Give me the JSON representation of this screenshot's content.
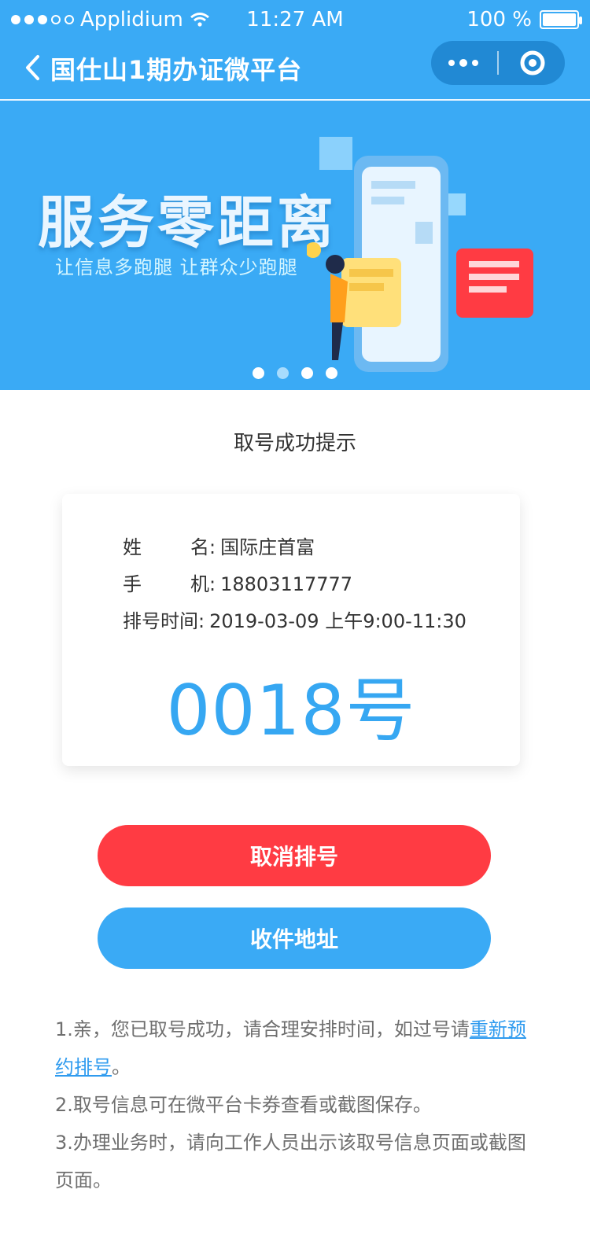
{
  "status_bar": {
    "carrier": "Applidium",
    "time": "11:27 AM",
    "battery_text": "100 %"
  },
  "nav": {
    "title": "国仕山1期办证微平台"
  },
  "banner": {
    "title": "服务零距离",
    "subtitle": "让信息多跑腿 让群众少跑腿",
    "active_index": 1
  },
  "section": {
    "title": "取号成功提示"
  },
  "ticket_card": {
    "fields": [
      {
        "label": "姓名",
        "value": "国际庄首富"
      },
      {
        "label": "手机",
        "value": "18803117777"
      },
      {
        "label": "排号时间",
        "value": "2019-03-09 上午9:00-11:30"
      }
    ],
    "ticket_number": "0018号"
  },
  "actions": {
    "cancel_label": "取消排号",
    "address_label": "收件地址"
  },
  "notes": {
    "line1_prefix": "1.亲，您已取号成功，请合理安排时间，如过号请",
    "line1_link": "重新预约排号",
    "line1_suffix": "。",
    "line2": "2.取号信息可在微平台卡券查看或截图保存。",
    "line3": "3.办理业务时，请向工作人员出示该取号信息页面或截图页面。"
  },
  "colors": {
    "primary": "#3aaaf5",
    "danger": "#ff3b43",
    "accent": "#36a7f2"
  },
  "icons": {
    "back": "chevron-left",
    "menu": "more-dots",
    "target": "target-ring"
  }
}
